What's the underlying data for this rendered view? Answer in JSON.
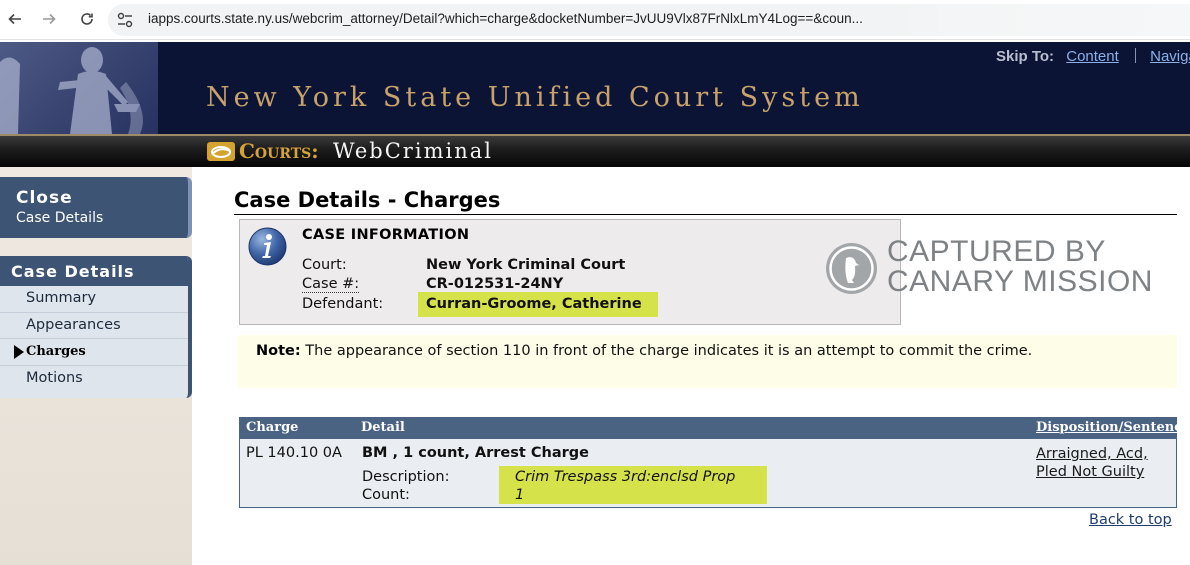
{
  "browser": {
    "url": "iapps.courts.state.ny.us/webcrim_attorney/Detail?which=charge&docketNumber=JvUU9Vlx87FrNlxLmY4Log==&coun...",
    "icons": [
      "back-arrow-icon",
      "forward-arrow-icon",
      "reload-icon",
      "site-info-icon"
    ]
  },
  "banner": {
    "skip_label": "Skip To:",
    "skip_content": "Content",
    "skip_navigation": "Naviga",
    "title": "New York State Unified Court System",
    "courts_label": "Courts:",
    "app_name": "WebCriminal"
  },
  "sidebar": {
    "close_title": "Close",
    "close_sub": "Case Details",
    "menu_title": "Case Details",
    "items": [
      {
        "label": "Summary"
      },
      {
        "label": "Appearances"
      },
      {
        "label": "Charges"
      },
      {
        "label": "Motions"
      }
    ]
  },
  "main": {
    "title": "Case Details - Charges",
    "case_info": {
      "heading": "CASE INFORMATION",
      "court_label": "Court:",
      "court_value": "New York Criminal Court",
      "case_label": "Case #:",
      "case_value": "CR-012531-24NY",
      "defendant_label": "Defendant:",
      "defendant_value": "Curran-Groome, Catherine"
    },
    "watermark": {
      "line1": "CAPTURED BY",
      "line2": "CANARY MISSION"
    },
    "note": {
      "label": "Note:",
      "text": " The appearance of section 110 in front of the charge indicates it is an attempt to commit the crime."
    },
    "charges": {
      "headers": {
        "charge": "Charge",
        "detail": "Detail",
        "disposition": "Disposition/Sentence"
      },
      "row": {
        "charge": "PL 140.10 0A",
        "detail_title": "BM , 1 count, Arrest Charge",
        "description_label": "Description:",
        "description_value": "Crim Trespass 3rd:enclsd Prop",
        "count_label": "Count:",
        "count_value": "1",
        "disposition_line1": "Arraigned, Acd,",
        "disposition_line2": "Pled Not Guilty"
      }
    },
    "back_to_top": "Back to top"
  },
  "colors": {
    "banner_bg": "#0b1434",
    "banner_title": "#c8a26a",
    "sidebar_blue": "#3d5474",
    "highlight": "#d6e24a",
    "note_bg": "#fefde8",
    "table_header": "#4b6383"
  }
}
